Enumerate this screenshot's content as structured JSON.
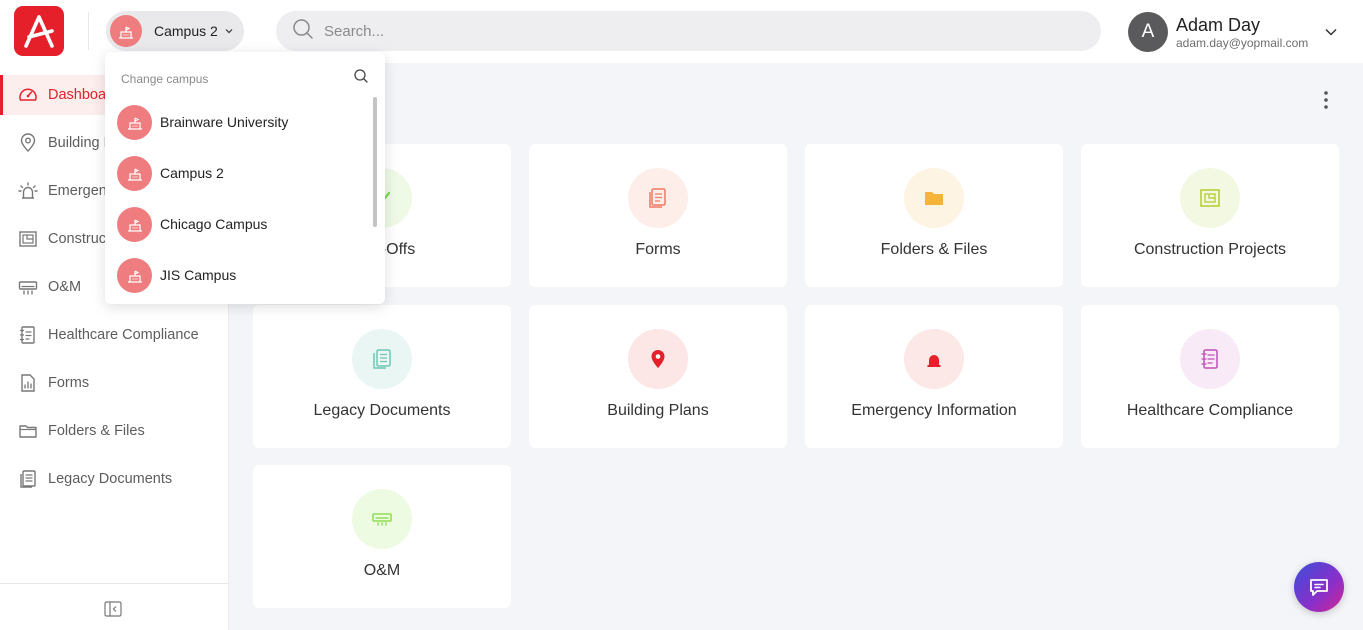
{
  "header": {
    "logo_icon": "brand-logo-a",
    "campus_selector_label": "Campus 2",
    "search_placeholder": "Search...",
    "user": {
      "initial": "A",
      "name": "Adam Day",
      "email": "adam.day@yopmail.com"
    }
  },
  "sidebar": {
    "items": [
      {
        "label": "Dashboard",
        "icon": "speedometer-icon",
        "active": true
      },
      {
        "label": "Building Plans",
        "icon": "map-pin-icon"
      },
      {
        "label": "Emergency Information",
        "icon": "alarm-icon"
      },
      {
        "label": "Construction Projects",
        "icon": "blueprint-icon"
      },
      {
        "label": "O&M",
        "icon": "air-conditioner-icon"
      },
      {
        "label": "Healthcare Compliance",
        "icon": "notebook-icon"
      },
      {
        "label": "Forms",
        "icon": "form-icon"
      },
      {
        "label": "Folders & Files",
        "icon": "folder-icon"
      },
      {
        "label": "Legacy Documents",
        "icon": "documents-icon"
      }
    ]
  },
  "dropdown": {
    "title": "Change campus",
    "items": [
      {
        "label": "Brainware University"
      },
      {
        "label": "Campus 2"
      },
      {
        "label": "Chicago Campus"
      },
      {
        "label": "JIS Campus"
      }
    ]
  },
  "cards": [
    {
      "label": "Sign-Offs",
      "icon": "signoff-icon",
      "color": "#7ed957",
      "bg": "#eef9e6"
    },
    {
      "label": "Forms",
      "icon": "form-icon",
      "color": "#f07a63",
      "bg": "#fdeeea"
    },
    {
      "label": "Folders & Files",
      "icon": "folder-icon",
      "color": "#f5b337",
      "bg": "#fef4e4"
    },
    {
      "label": "Construction Projects",
      "icon": "blueprint-icon",
      "color": "#b8cf3a",
      "bg": "#f3f8e3"
    },
    {
      "label": "Legacy Documents",
      "icon": "documents-icon",
      "color": "#6fc7b3",
      "bg": "#e9f6f3"
    },
    {
      "label": "Building Plans",
      "icon": "map-pin-icon",
      "color": "#e5202a",
      "bg": "#fde6e6"
    },
    {
      "label": "Emergency Information",
      "icon": "alarm-icon",
      "color": "#e5202a",
      "bg": "#fde8e8"
    },
    {
      "label": "Healthcare Compliance",
      "icon": "notebook-icon",
      "color": "#c04fb7",
      "bg": "#f8eaf7"
    },
    {
      "label": "O&M",
      "icon": "air-conditioner-icon",
      "color": "#8fe04f",
      "bg": "#eefbe3"
    }
  ],
  "colors": {
    "brand": "#e5202a",
    "campus_avatar": "#ef7d7f"
  }
}
